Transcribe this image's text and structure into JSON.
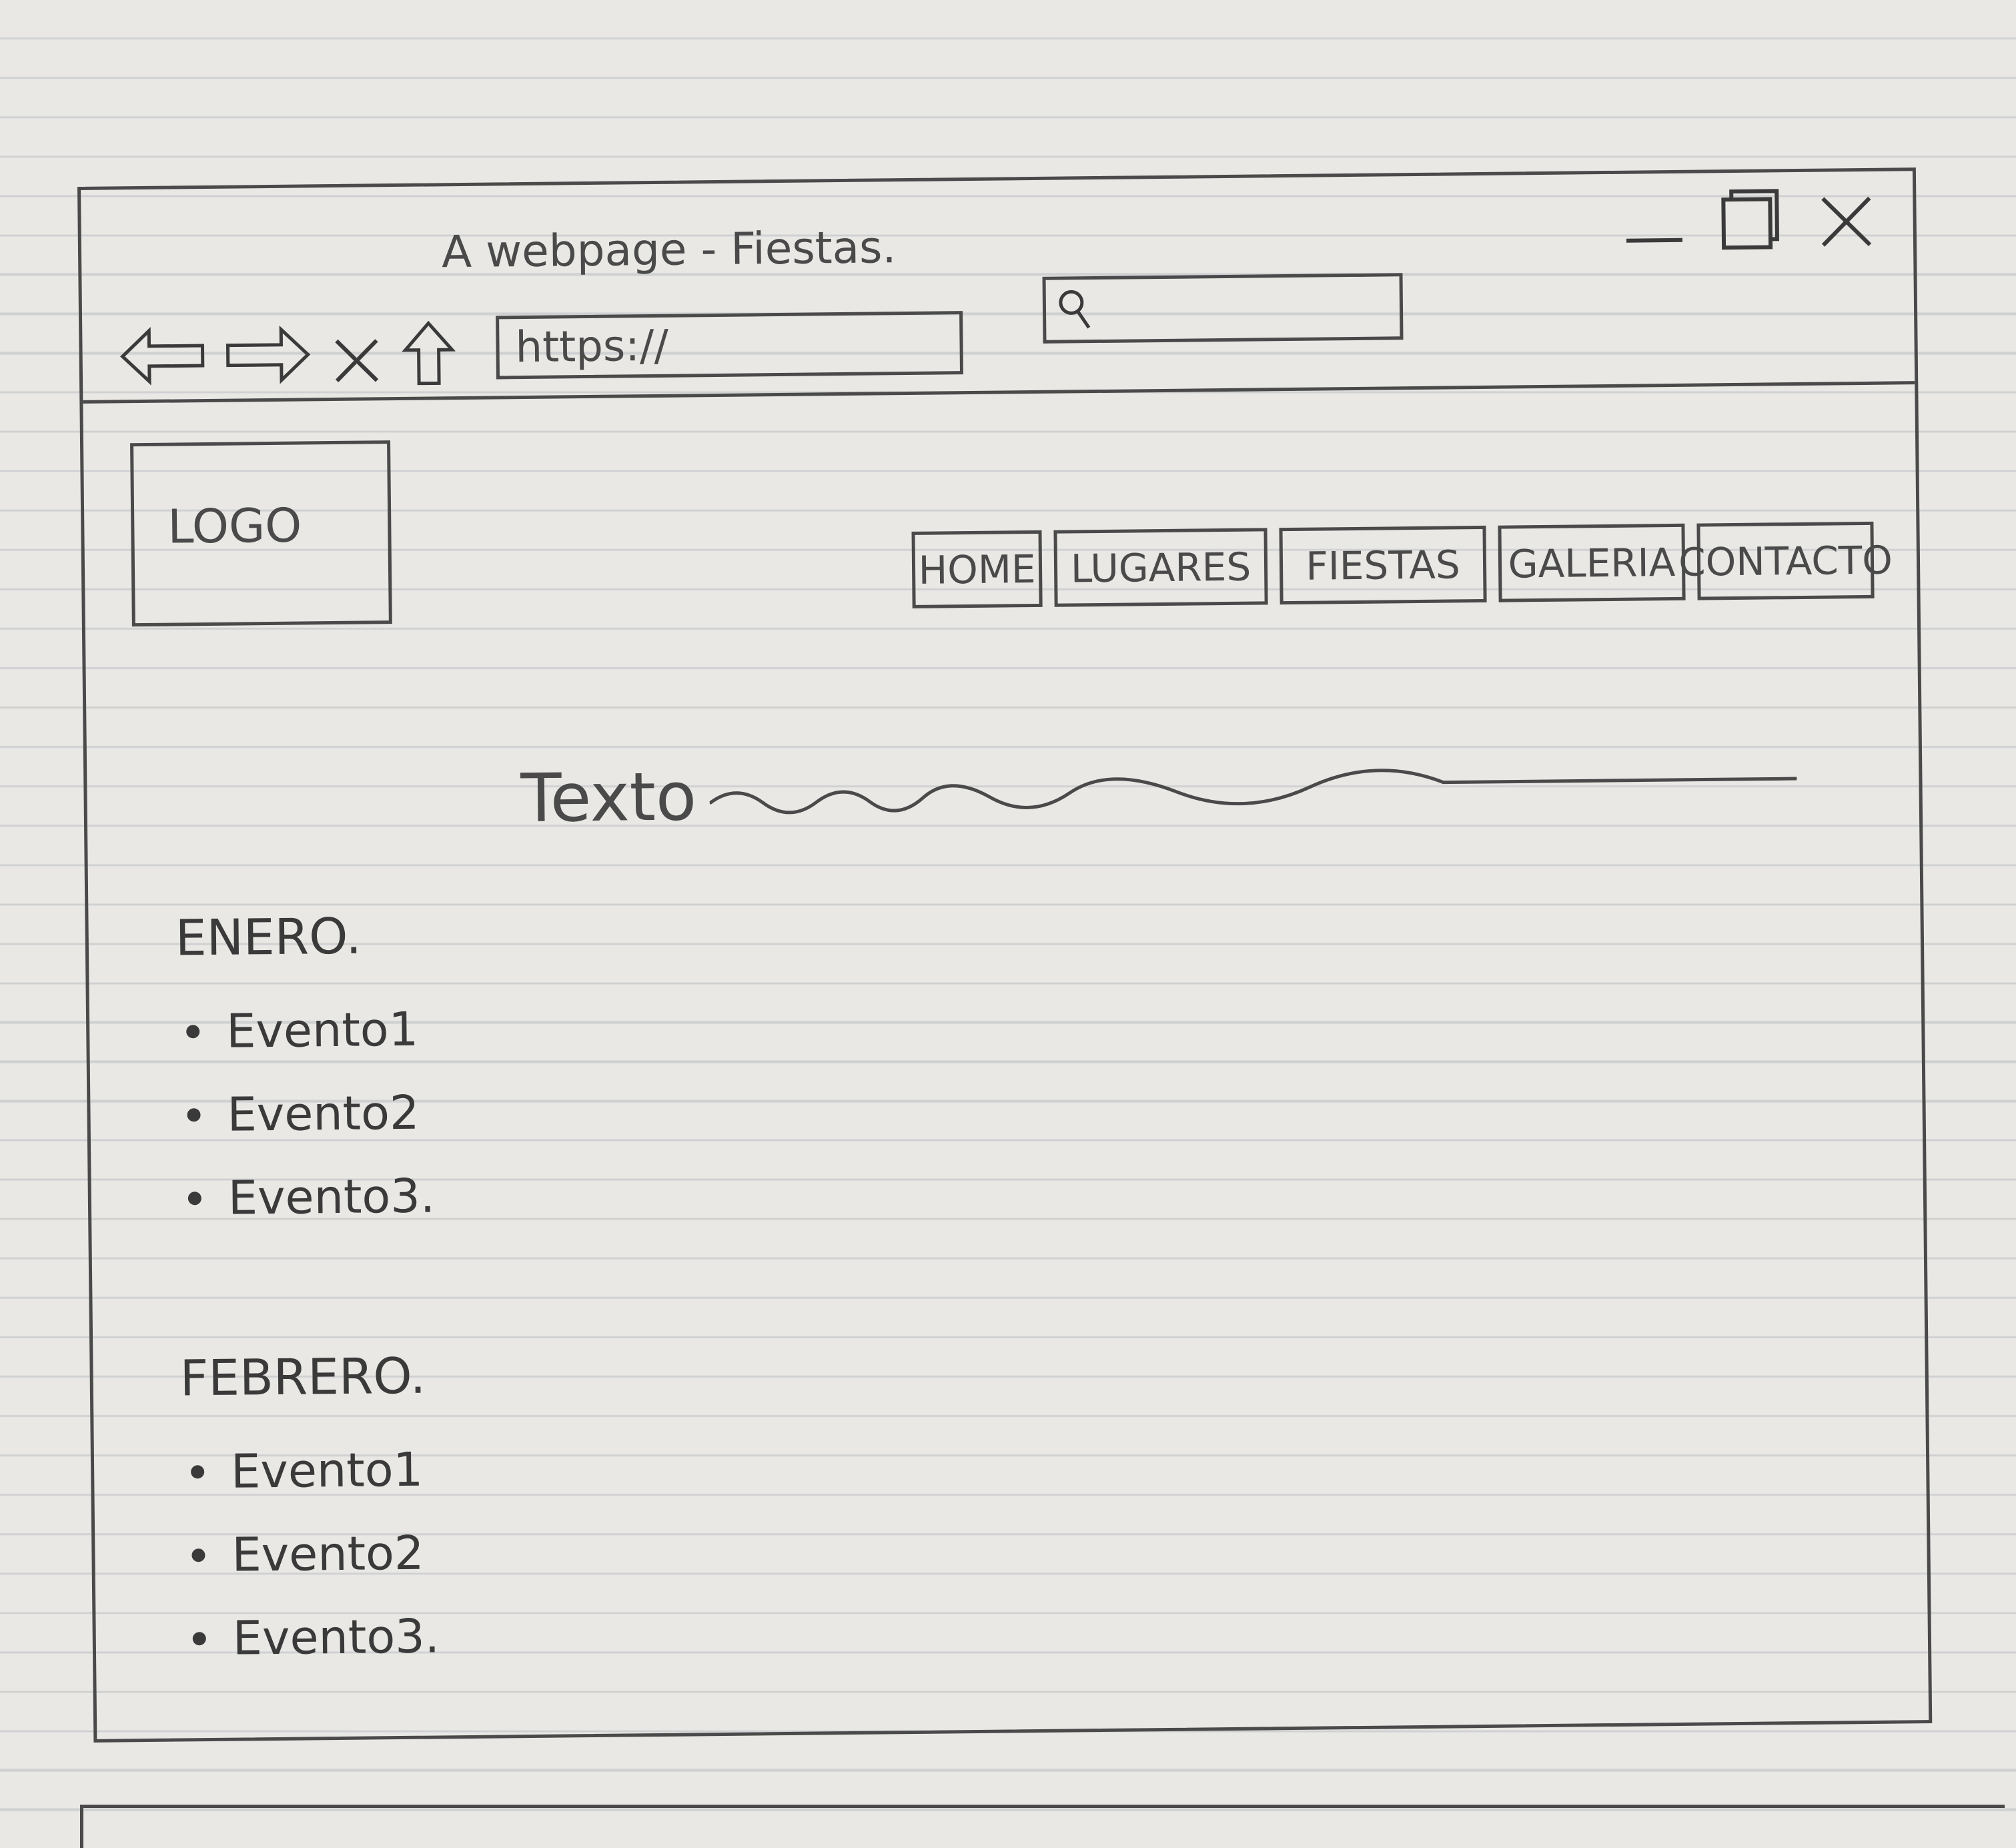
{
  "window": {
    "title": "A webpage - Fiestas.",
    "controls": [
      "minimize",
      "maximize",
      "close"
    ]
  },
  "browser": {
    "url": "https://",
    "search_icon": "search-icon"
  },
  "page": {
    "logo": "LOGO",
    "nav": [
      "HOME",
      "LUGARES",
      "FIESTAS",
      "GALERIA",
      "CONTACTO"
    ],
    "heading": "Texto",
    "sections": [
      {
        "month": "ENERO.",
        "events": [
          "Evento1",
          "Evento2",
          "Evento3."
        ]
      },
      {
        "month": "FEBRERO.",
        "events": [
          "Evento1",
          "Evento2",
          "Evento3."
        ]
      }
    ]
  }
}
